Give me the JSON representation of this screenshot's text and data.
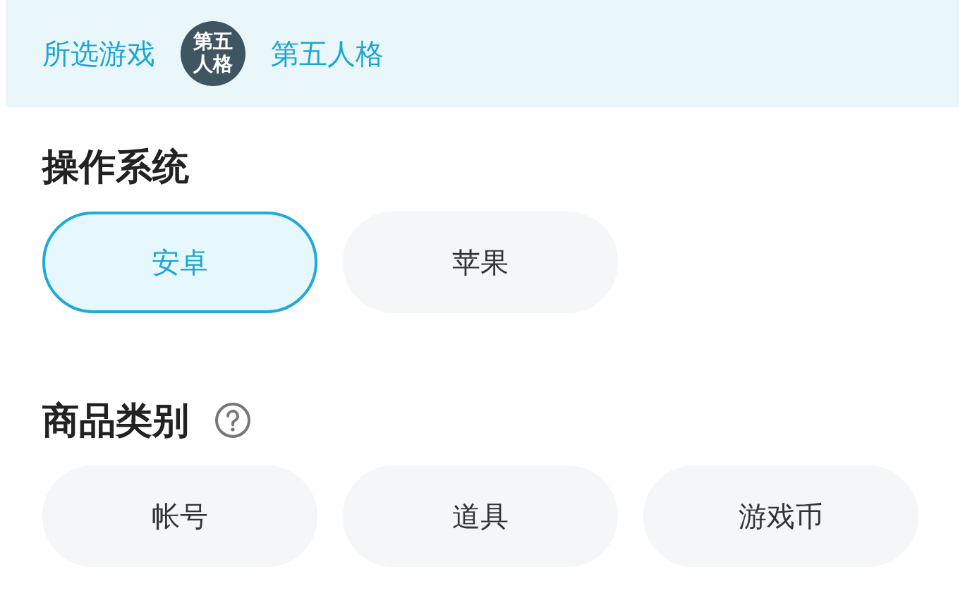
{
  "selected_game": {
    "label": "所选游戏",
    "icon_text": "第五人格",
    "name": "第五人格"
  },
  "sections": [
    {
      "title": "操作系统",
      "help": false,
      "options": [
        {
          "label": "安卓",
          "selected": true
        },
        {
          "label": "苹果",
          "selected": false
        }
      ]
    },
    {
      "title": "商品类别",
      "help": true,
      "options": [
        {
          "label": "帐号",
          "selected": false
        },
        {
          "label": "道具",
          "selected": false
        },
        {
          "label": "游戏币",
          "selected": false
        }
      ]
    }
  ]
}
